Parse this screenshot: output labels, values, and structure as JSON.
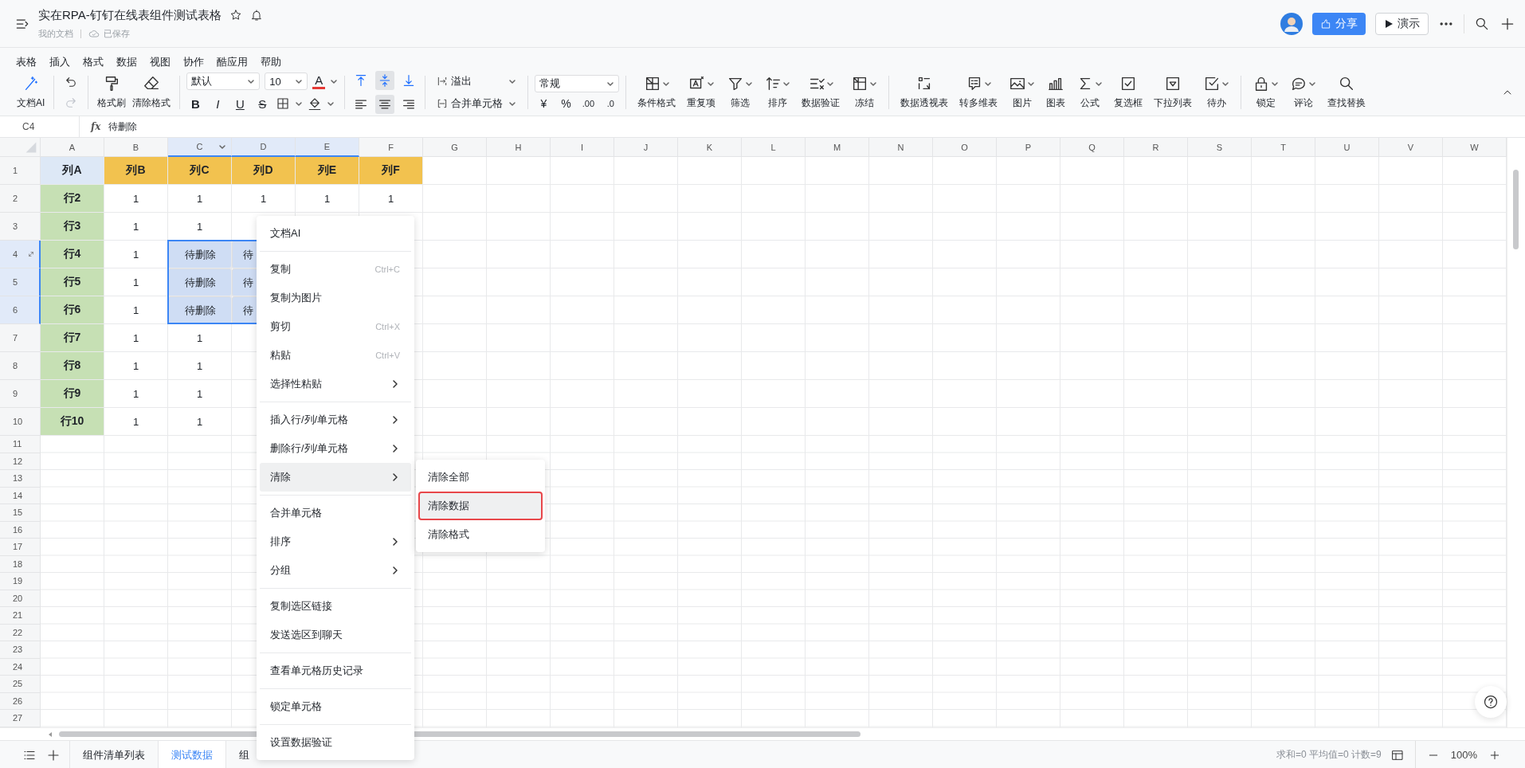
{
  "title_bar": {
    "title": "实在RPA-钉钉在线表组件测试表格",
    "breadcrumb": "我的文档",
    "save_status": "已保存",
    "share": "分享",
    "present": "演示"
  },
  "menu_bar": [
    "表格",
    "插入",
    "格式",
    "数据",
    "视图",
    "协作",
    "酷应用",
    "帮助"
  ],
  "toolbar": {
    "ai": "文档AI",
    "history": [
      {
        "disabled": false
      },
      {
        "disabled": true
      }
    ],
    "paint": [
      "格式刷",
      "清除格式"
    ],
    "font_name": "默认",
    "font_size": "10",
    "font_color_label": "A",
    "styles": [
      "B",
      "I",
      "U",
      "S"
    ],
    "valign": [
      {
        "selected": false
      },
      {
        "selected": true
      },
      {
        "selected": false
      }
    ],
    "halign": [
      {
        "selected": false
      },
      {
        "selected": true
      },
      {
        "selected": false
      }
    ],
    "overflow": "溢出",
    "merge": "合并单元格",
    "number_format": "常规",
    "currency": "¥",
    "percent": "%",
    "decimals": [
      ".00",
      ".0"
    ],
    "tool_groups": [
      [
        {
          "label": "条件格式",
          "caret": true
        },
        {
          "label": "重复项",
          "caret": true
        },
        {
          "label": "筛选",
          "caret": true
        },
        {
          "label": "排序",
          "caret": true
        },
        {
          "label": "数据验证",
          "caret": true
        },
        {
          "label": "冻结",
          "caret": true
        }
      ],
      [
        {
          "label": "数据透视表",
          "caret": false
        },
        {
          "label": "转多维表",
          "caret": true
        },
        {
          "label": "图片",
          "caret": true
        },
        {
          "label": "图表",
          "caret": false
        },
        {
          "label": "公式",
          "caret": true
        },
        {
          "label": "复选框",
          "caret": false
        },
        {
          "label": "下拉列表",
          "caret": false
        },
        {
          "label": "待办",
          "caret": true
        }
      ],
      [
        {
          "label": "锁定",
          "caret": true
        },
        {
          "label": "评论",
          "caret": true
        },
        {
          "label": "查找替换",
          "caret": false
        }
      ]
    ]
  },
  "formula_bar": {
    "name_box": "C4",
    "fx": "fx",
    "formula": "待删除"
  },
  "sheet": {
    "columns": [
      {
        "label": "A",
        "selected": false,
        "caret": false
      },
      {
        "label": "B",
        "selected": false,
        "caret": false
      },
      {
        "label": "C",
        "selected": true,
        "caret": true
      },
      {
        "label": "D",
        "selected": true,
        "caret": false
      },
      {
        "label": "E",
        "selected": true,
        "caret": false
      },
      {
        "label": "F",
        "selected": false,
        "caret": false
      },
      {
        "label": "G",
        "selected": false,
        "caret": false
      },
      {
        "label": "H",
        "selected": false,
        "caret": false
      },
      {
        "label": "I",
        "selected": false,
        "caret": false
      },
      {
        "label": "J",
        "selected": false,
        "caret": false
      },
      {
        "label": "K",
        "selected": false,
        "caret": false
      },
      {
        "label": "L",
        "selected": false,
        "caret": false
      },
      {
        "label": "M",
        "selected": false,
        "caret": false
      },
      {
        "label": "N",
        "selected": false,
        "caret": false
      },
      {
        "label": "O",
        "selected": false,
        "caret": false
      },
      {
        "label": "P",
        "selected": false,
        "caret": false
      },
      {
        "label": "Q",
        "selected": false,
        "caret": false
      },
      {
        "label": "R",
        "selected": false,
        "caret": false
      },
      {
        "label": "S",
        "selected": false,
        "caret": false
      },
      {
        "label": "T",
        "selected": false,
        "caret": false
      },
      {
        "label": "U",
        "selected": false,
        "caret": false
      },
      {
        "label": "V",
        "selected": false,
        "caret": false
      },
      {
        "label": "W",
        "selected": false,
        "caret": false
      }
    ],
    "row_numbers": [
      {
        "label": "1",
        "selected": false
      },
      {
        "label": "2",
        "selected": false
      },
      {
        "label": "3",
        "selected": false
      },
      {
        "label": "4",
        "selected": true
      },
      {
        "label": "5",
        "selected": true
      },
      {
        "label": "6",
        "selected": true
      },
      {
        "label": "7",
        "selected": false
      },
      {
        "label": "8",
        "selected": false
      },
      {
        "label": "9",
        "selected": false
      },
      {
        "label": "10",
        "selected": false
      },
      {
        "label": "11",
        "selected": false
      },
      {
        "label": "12",
        "selected": false
      },
      {
        "label": "13",
        "selected": false
      },
      {
        "label": "14",
        "selected": false
      },
      {
        "label": "15",
        "selected": false
      },
      {
        "label": "16",
        "selected": false
      },
      {
        "label": "17",
        "selected": false
      },
      {
        "label": "18",
        "selected": false
      },
      {
        "label": "19",
        "selected": false
      },
      {
        "label": "20",
        "selected": false
      },
      {
        "label": "21",
        "selected": false
      },
      {
        "label": "22",
        "selected": false
      },
      {
        "label": "23",
        "selected": false
      },
      {
        "label": "24",
        "selected": false
      },
      {
        "label": "25",
        "selected": false
      },
      {
        "label": "26",
        "selected": false
      },
      {
        "label": "27",
        "selected": false
      }
    ],
    "rows": [
      [
        {
          "text": "列A",
          "color": "#dde8f6",
          "selected": false
        },
        {
          "text": "列B",
          "color": "#f2c24f",
          "selected": false
        },
        {
          "text": "列C",
          "color": "#f2c24f",
          "selected": false
        },
        {
          "text": "列D",
          "color": "#f2c24f",
          "selected": false
        },
        {
          "text": "列E",
          "color": "#f2c24f",
          "selected": false
        },
        {
          "text": "列F",
          "color": "#f2c24f",
          "selected": false
        }
      ],
      [
        {
          "text": "行2",
          "color": "#c6e0b4",
          "selected": false
        },
        {
          "text": "1",
          "selected": false
        },
        {
          "text": "1",
          "selected": false
        },
        {
          "text": "1",
          "selected": false
        },
        {
          "text": "1",
          "selected": false
        },
        {
          "text": "1",
          "selected": false
        }
      ],
      [
        {
          "text": "行3",
          "color": "#c6e0b4",
          "selected": false
        },
        {
          "text": "1",
          "selected": false
        },
        {
          "text": "1",
          "selected": false
        }
      ],
      [
        {
          "text": "行4",
          "color": "#c6e0b4",
          "selected": false
        },
        {
          "text": "1",
          "selected": false
        },
        {
          "text": "待删除",
          "selected": true
        },
        {
          "text": "待",
          "selected": true
        }
      ],
      [
        {
          "text": "行5",
          "color": "#c6e0b4",
          "selected": false
        },
        {
          "text": "1",
          "selected": false
        },
        {
          "text": "待删除",
          "selected": true
        },
        {
          "text": "待",
          "selected": true
        }
      ],
      [
        {
          "text": "行6",
          "color": "#c6e0b4",
          "selected": false
        },
        {
          "text": "1",
          "selected": false
        },
        {
          "text": "待删除",
          "selected": true
        },
        {
          "text": "待",
          "selected": true
        }
      ],
      [
        {
          "text": "行7",
          "color": "#c6e0b4",
          "selected": false
        },
        {
          "text": "1",
          "selected": false
        },
        {
          "text": "1",
          "selected": false
        }
      ],
      [
        {
          "text": "行8",
          "color": "#c6e0b4",
          "selected": false
        },
        {
          "text": "1",
          "selected": false
        },
        {
          "text": "1",
          "selected": false
        }
      ],
      [
        {
          "text": "行9",
          "color": "#c6e0b4",
          "selected": false
        },
        {
          "text": "1",
          "selected": false
        },
        {
          "text": "1",
          "selected": false
        }
      ],
      [
        {
          "text": "行10",
          "color": "#c6e0b4",
          "selected": false
        },
        {
          "text": "1",
          "selected": false
        },
        {
          "text": "1",
          "selected": false
        }
      ]
    ]
  },
  "context_menu": [
    {
      "kind": "item",
      "label": "文档AI",
      "selected": false
    },
    {
      "kind": "separator"
    },
    {
      "kind": "item",
      "label": "复制",
      "shortcut": "Ctrl+C",
      "selected": false
    },
    {
      "kind": "item",
      "label": "复制为图片",
      "selected": false
    },
    {
      "kind": "item",
      "label": "剪切",
      "shortcut": "Ctrl+X",
      "selected": false
    },
    {
      "kind": "item",
      "label": "粘贴",
      "shortcut": "Ctrl+V",
      "selected": false
    },
    {
      "kind": "submenu",
      "label": "选择性粘贴",
      "selected": false
    },
    {
      "kind": "separator"
    },
    {
      "kind": "submenu",
      "label": "插入行/列/单元格",
      "selected": false
    },
    {
      "kind": "submenu",
      "label": "删除行/列/单元格",
      "selected": false
    },
    {
      "kind": "submenu",
      "label": "清除",
      "selected": true
    },
    {
      "kind": "separator"
    },
    {
      "kind": "item",
      "label": "合并单元格",
      "selected": false
    },
    {
      "kind": "submenu",
      "label": "排序",
      "selected": false
    },
    {
      "kind": "submenu",
      "label": "分组",
      "selected": false
    },
    {
      "kind": "separator"
    },
    {
      "kind": "item",
      "label": "复制选区链接",
      "selected": false
    },
    {
      "kind": "item",
      "label": "发送选区到聊天",
      "selected": false
    },
    {
      "kind": "separator"
    },
    {
      "kind": "item",
      "label": "查看单元格历史记录",
      "selected": false
    },
    {
      "kind": "separator"
    },
    {
      "kind": "item",
      "label": "锁定单元格",
      "selected": false
    },
    {
      "kind": "separator"
    },
    {
      "kind": "item",
      "label": "设置数据验证",
      "selected": false
    }
  ],
  "submenu": [
    {
      "label": "清除全部",
      "selected": false
    },
    {
      "label": "清除数据",
      "selected": true
    },
    {
      "label": "清除格式",
      "selected": false
    }
  ],
  "sheet_tabs": [
    {
      "label": "组件清单列表",
      "selected": false
    },
    {
      "label": "测试数据",
      "selected": true
    },
    {
      "label": "组",
      "selected": false
    }
  ],
  "status_bar": {
    "summary": "求和=0 平均值=0 计数=9",
    "zoom": "100%"
  }
}
